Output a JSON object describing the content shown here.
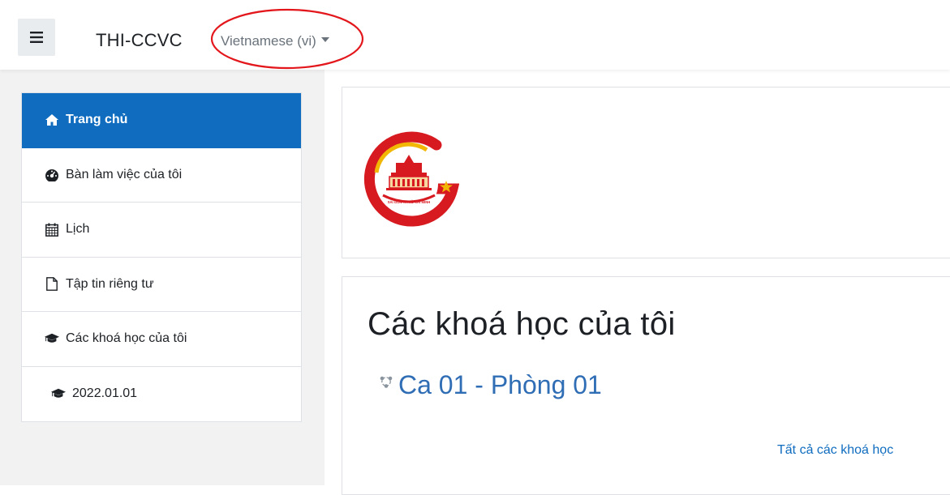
{
  "navbar": {
    "site_name": "THI-CCVC",
    "language_label": "Vietnamese (vi)",
    "menu_icon": "hamburger-icon"
  },
  "sidebar": {
    "items": [
      {
        "label": "Trang chủ",
        "icon": "home-icon",
        "active": true
      },
      {
        "label": "Bàn làm việc của tôi",
        "icon": "dashboard-icon",
        "active": false
      },
      {
        "label": "Lịch",
        "icon": "calendar-icon",
        "active": false
      },
      {
        "label": "Tập tin riêng tư",
        "icon": "file-icon",
        "active": false
      },
      {
        "label": "Các khoá học của tôi",
        "icon": "graduation-cap-icon",
        "active": false
      },
      {
        "label": "2022.01.01",
        "icon": "graduation-cap-icon",
        "active": false
      }
    ]
  },
  "main": {
    "logo_text": "SÀI GÒN TP. HỒ CHÍ MINH",
    "courses": {
      "title": "Các khoá học của tôi",
      "items": [
        {
          "label": "Ca 01 - Phòng 01",
          "icon": "course-icon"
        }
      ],
      "all_courses_link": "Tất cả các khoá học"
    }
  },
  "colors": {
    "accent": "#0f6cbf",
    "link": "#2f6db5",
    "annotation": "#e3161b",
    "drawer_bg": "#f2f2f2"
  }
}
